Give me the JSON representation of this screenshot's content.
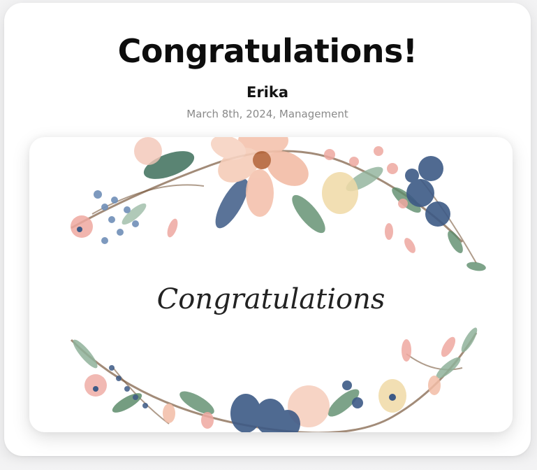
{
  "card": {
    "title": "Congratulations!",
    "recipient": "Erika",
    "meta": "March 8th, 2024, Management",
    "image_caption": "Congratulations"
  },
  "colors": {
    "peach": "#f4c2ad",
    "blush": "#eea8a0",
    "navy": "#3d5a86",
    "slate_blue": "#6f8fb8",
    "leaf_green": "#5d8c6b",
    "sage": "#8fb29a",
    "stem_brown": "#7a5a3e",
    "cream": "#f0d9a6"
  }
}
